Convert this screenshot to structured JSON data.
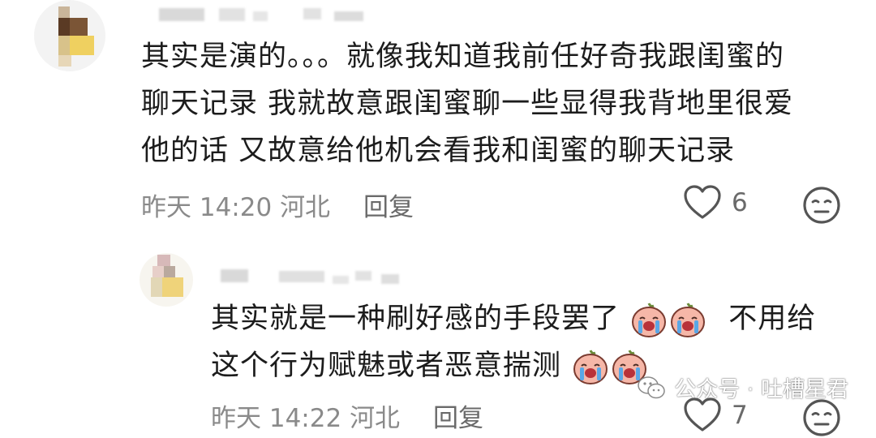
{
  "comments": [
    {
      "text_lines": [
        "其实是演的。。。就像我知道我前任好奇我跟闺蜜的",
        "聊天记录 我就故意跟闺蜜聊一些显得我背地里很爱",
        "他的话 又故意给他机会看我和闺蜜的聊天记录"
      ],
      "time": "昨天 14:20",
      "location": "河北",
      "reply_label": "回复",
      "like_count": "6"
    },
    {
      "text_line1": "其实就是一种刷好感的手段罢了",
      "text_line1_tail": "不用给",
      "text_line2": "这个行为赋魅或者恶意揣测",
      "time": "昨天 14:22",
      "location": "河北",
      "reply_label": "回复",
      "like_count": "7"
    }
  ],
  "watermark": "公众号 · 吐槽星君",
  "icons": {
    "heart": "heart-outline-icon",
    "emoji": "neutral-face-icon",
    "sticker": "crying-peach-sticker",
    "wechat": "wechat-logo-icon"
  }
}
